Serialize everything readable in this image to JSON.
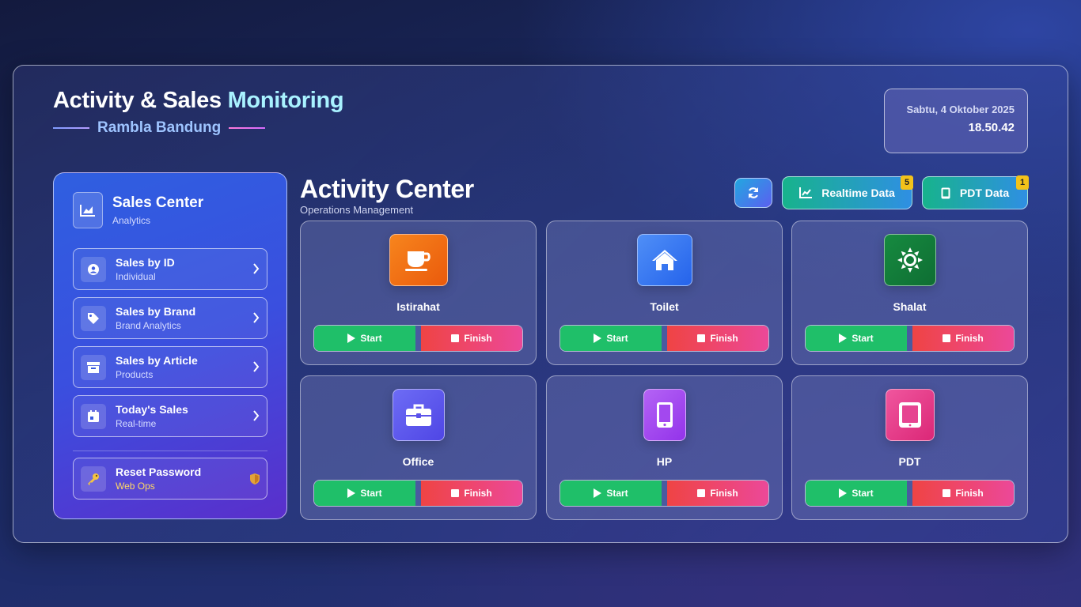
{
  "header": {
    "title_part1": "Activity & Sales ",
    "title_part2": "Monitoring",
    "subtitle": "Rambla Bandung",
    "date": "Sabtu, 4 Oktober 2025",
    "time": "18.50.42"
  },
  "sidebar": {
    "title": "Sales Center",
    "subtitle": "Analytics",
    "items": [
      {
        "label": "Sales by ID",
        "sub": "Individual",
        "icon": "user-circle-icon"
      },
      {
        "label": "Sales by Brand",
        "sub": "Brand Analytics",
        "icon": "tag-icon"
      },
      {
        "label": "Sales by Article",
        "sub": "Products",
        "icon": "archive-box-icon"
      },
      {
        "label": "Today's Sales",
        "sub": "Real-time",
        "icon": "calendar-icon"
      }
    ],
    "reset": {
      "label": "Reset Password",
      "sub": "Web Ops",
      "icon": "key-icon"
    }
  },
  "activity": {
    "title": "Activity Center",
    "subtitle": "Operations Management",
    "realtime_label": "Realtime Data",
    "realtime_badge": "5",
    "pdt_label": "PDT Data",
    "pdt_badge": "1",
    "start_label": "Start",
    "finish_label": "Finish",
    "cards": [
      {
        "name": "Istirahat",
        "icon": "coffee-cup-icon",
        "color": "#f0761c"
      },
      {
        "name": "Toilet",
        "icon": "home-icon",
        "color": "#3b82f6"
      },
      {
        "name": "Shalat",
        "icon": "sun-icon",
        "color": "#15803d"
      },
      {
        "name": "Office",
        "icon": "briefcase-icon",
        "color": "#6366f1"
      },
      {
        "name": "HP",
        "icon": "mobile-phone-icon",
        "color": "#a855f7"
      },
      {
        "name": "PDT",
        "icon": "tablet-icon",
        "color": "#ec4899"
      }
    ]
  }
}
